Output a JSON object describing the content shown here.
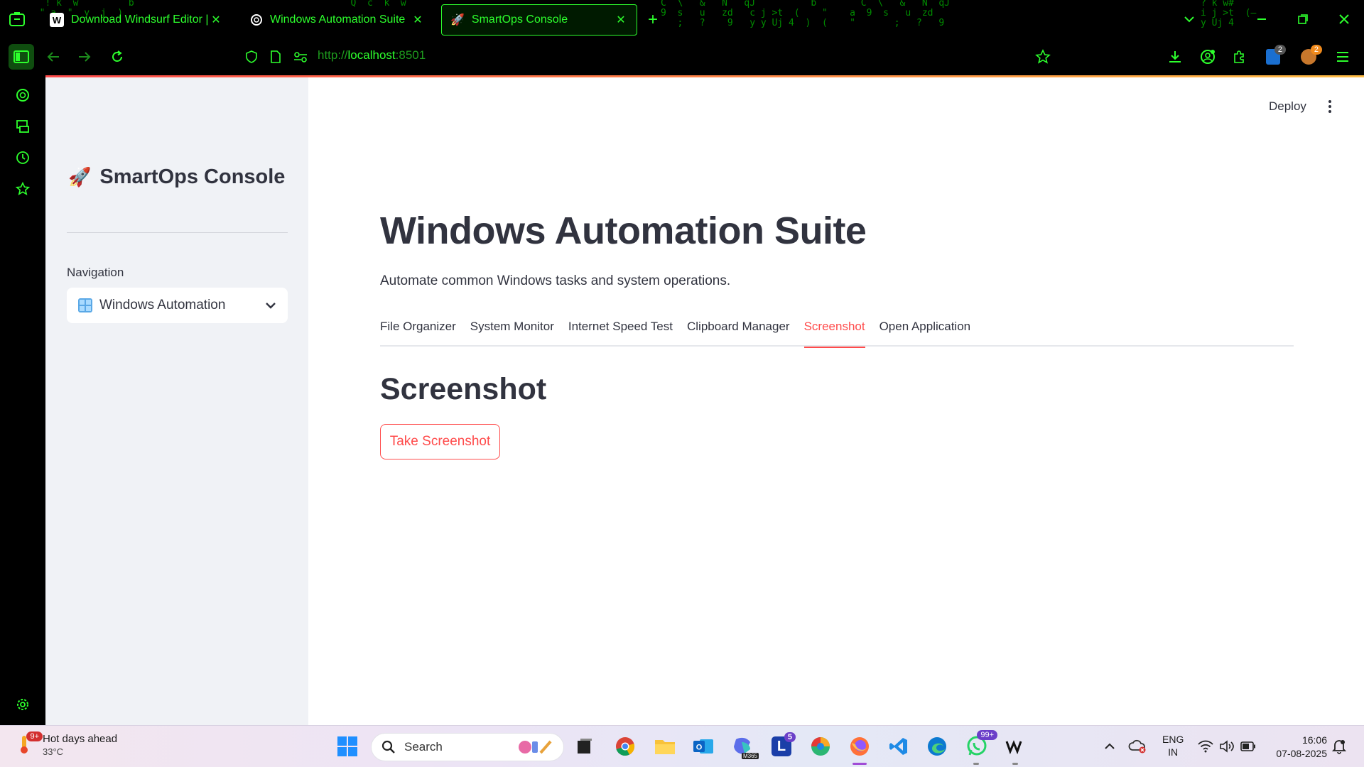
{
  "browser": {
    "tabs": [
      {
        "label": "Download Windsurf Editor | Wi",
        "icon": "windsurf-icon",
        "active": false
      },
      {
        "label": "Windows Automation Suite",
        "icon": "openai-icon",
        "active": false
      },
      {
        "label": "SmartOps Console",
        "icon": "rocket-icon",
        "active": true
      }
    ],
    "url_scheme": "http://",
    "url_host": "localhost",
    "url_port": ":8501",
    "tab_badge_1": "2",
    "tab_badge_2": "2"
  },
  "sidebar": {
    "app_icon": "🚀",
    "app_title": "SmartOps Console",
    "nav_label": "Navigation",
    "nav_selected": "Windows Automation"
  },
  "header": {
    "deploy_label": "Deploy"
  },
  "main": {
    "title": "Windows Automation Suite",
    "subtitle": "Automate common Windows tasks and system operations.",
    "tabs": [
      {
        "label": "File Organizer",
        "active": false
      },
      {
        "label": "System Monitor",
        "active": false
      },
      {
        "label": "Internet Speed Test",
        "active": false
      },
      {
        "label": "Clipboard Manager",
        "active": false
      },
      {
        "label": "Screenshot",
        "active": true
      },
      {
        "label": "Open Application",
        "active": false
      }
    ],
    "section_title": "Screenshot",
    "button_label": "Take Screenshot"
  },
  "taskbar": {
    "weather_title": "Hot days ahead",
    "weather_temp": "33°C",
    "weather_badge": "9+",
    "search_label": "Search",
    "lens_badge": "5",
    "whatsapp_badge": "99+",
    "lang_top": "ENG",
    "lang_bottom": "IN",
    "time": "16:06",
    "date": "07-08-2025",
    "m365_label": "M365"
  },
  "colors": {
    "accent": "#ff4b4b",
    "browser_green": "#2dff2d",
    "text": "#31333f",
    "sidebar_bg": "#f0f2f6"
  }
}
